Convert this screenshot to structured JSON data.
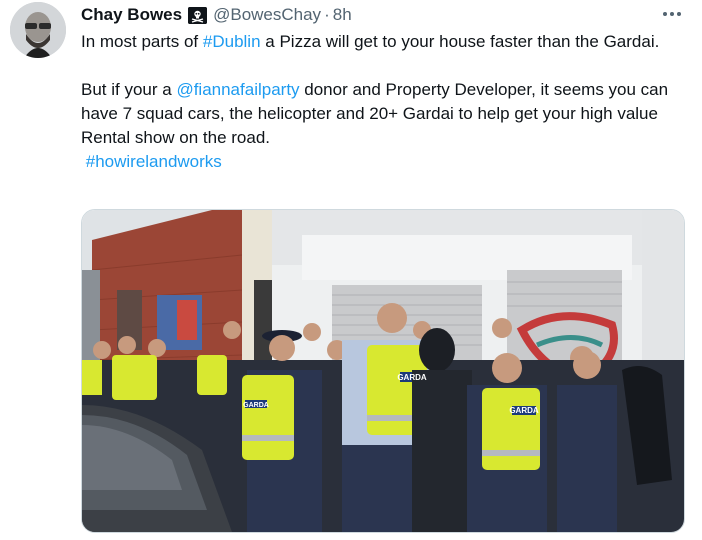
{
  "author": {
    "name": "Chay Bowes",
    "handle": "@BowesChay",
    "separator": "·",
    "time": "8h",
    "badge_icon": "skull-crossbones-flag-icon"
  },
  "more_icon": "ellipsis-icon",
  "tweet": {
    "line1_pre": "In most parts of ",
    "line1_hashtag": "#Dublin",
    "line1_post": " a Pizza will get to your house faster than the Gardai.",
    "line2_pre": "But if your a ",
    "line2_mention": "@fiannafailparty",
    "line2_post": " donor and Property Developer, it seems you can have 7 squad cars, the helicopter and 20+ Gardai to help get your high value Rental show on the road.",
    "hashtag2": "#howirelandworks"
  },
  "photo": {
    "vest_label": "GARDA",
    "colors": {
      "hi_vis": "#d8e830",
      "uniform": "#2b3550",
      "brick": "#9b4636",
      "shutter": "#c9cacc",
      "sky": "#dfe3e6"
    }
  }
}
